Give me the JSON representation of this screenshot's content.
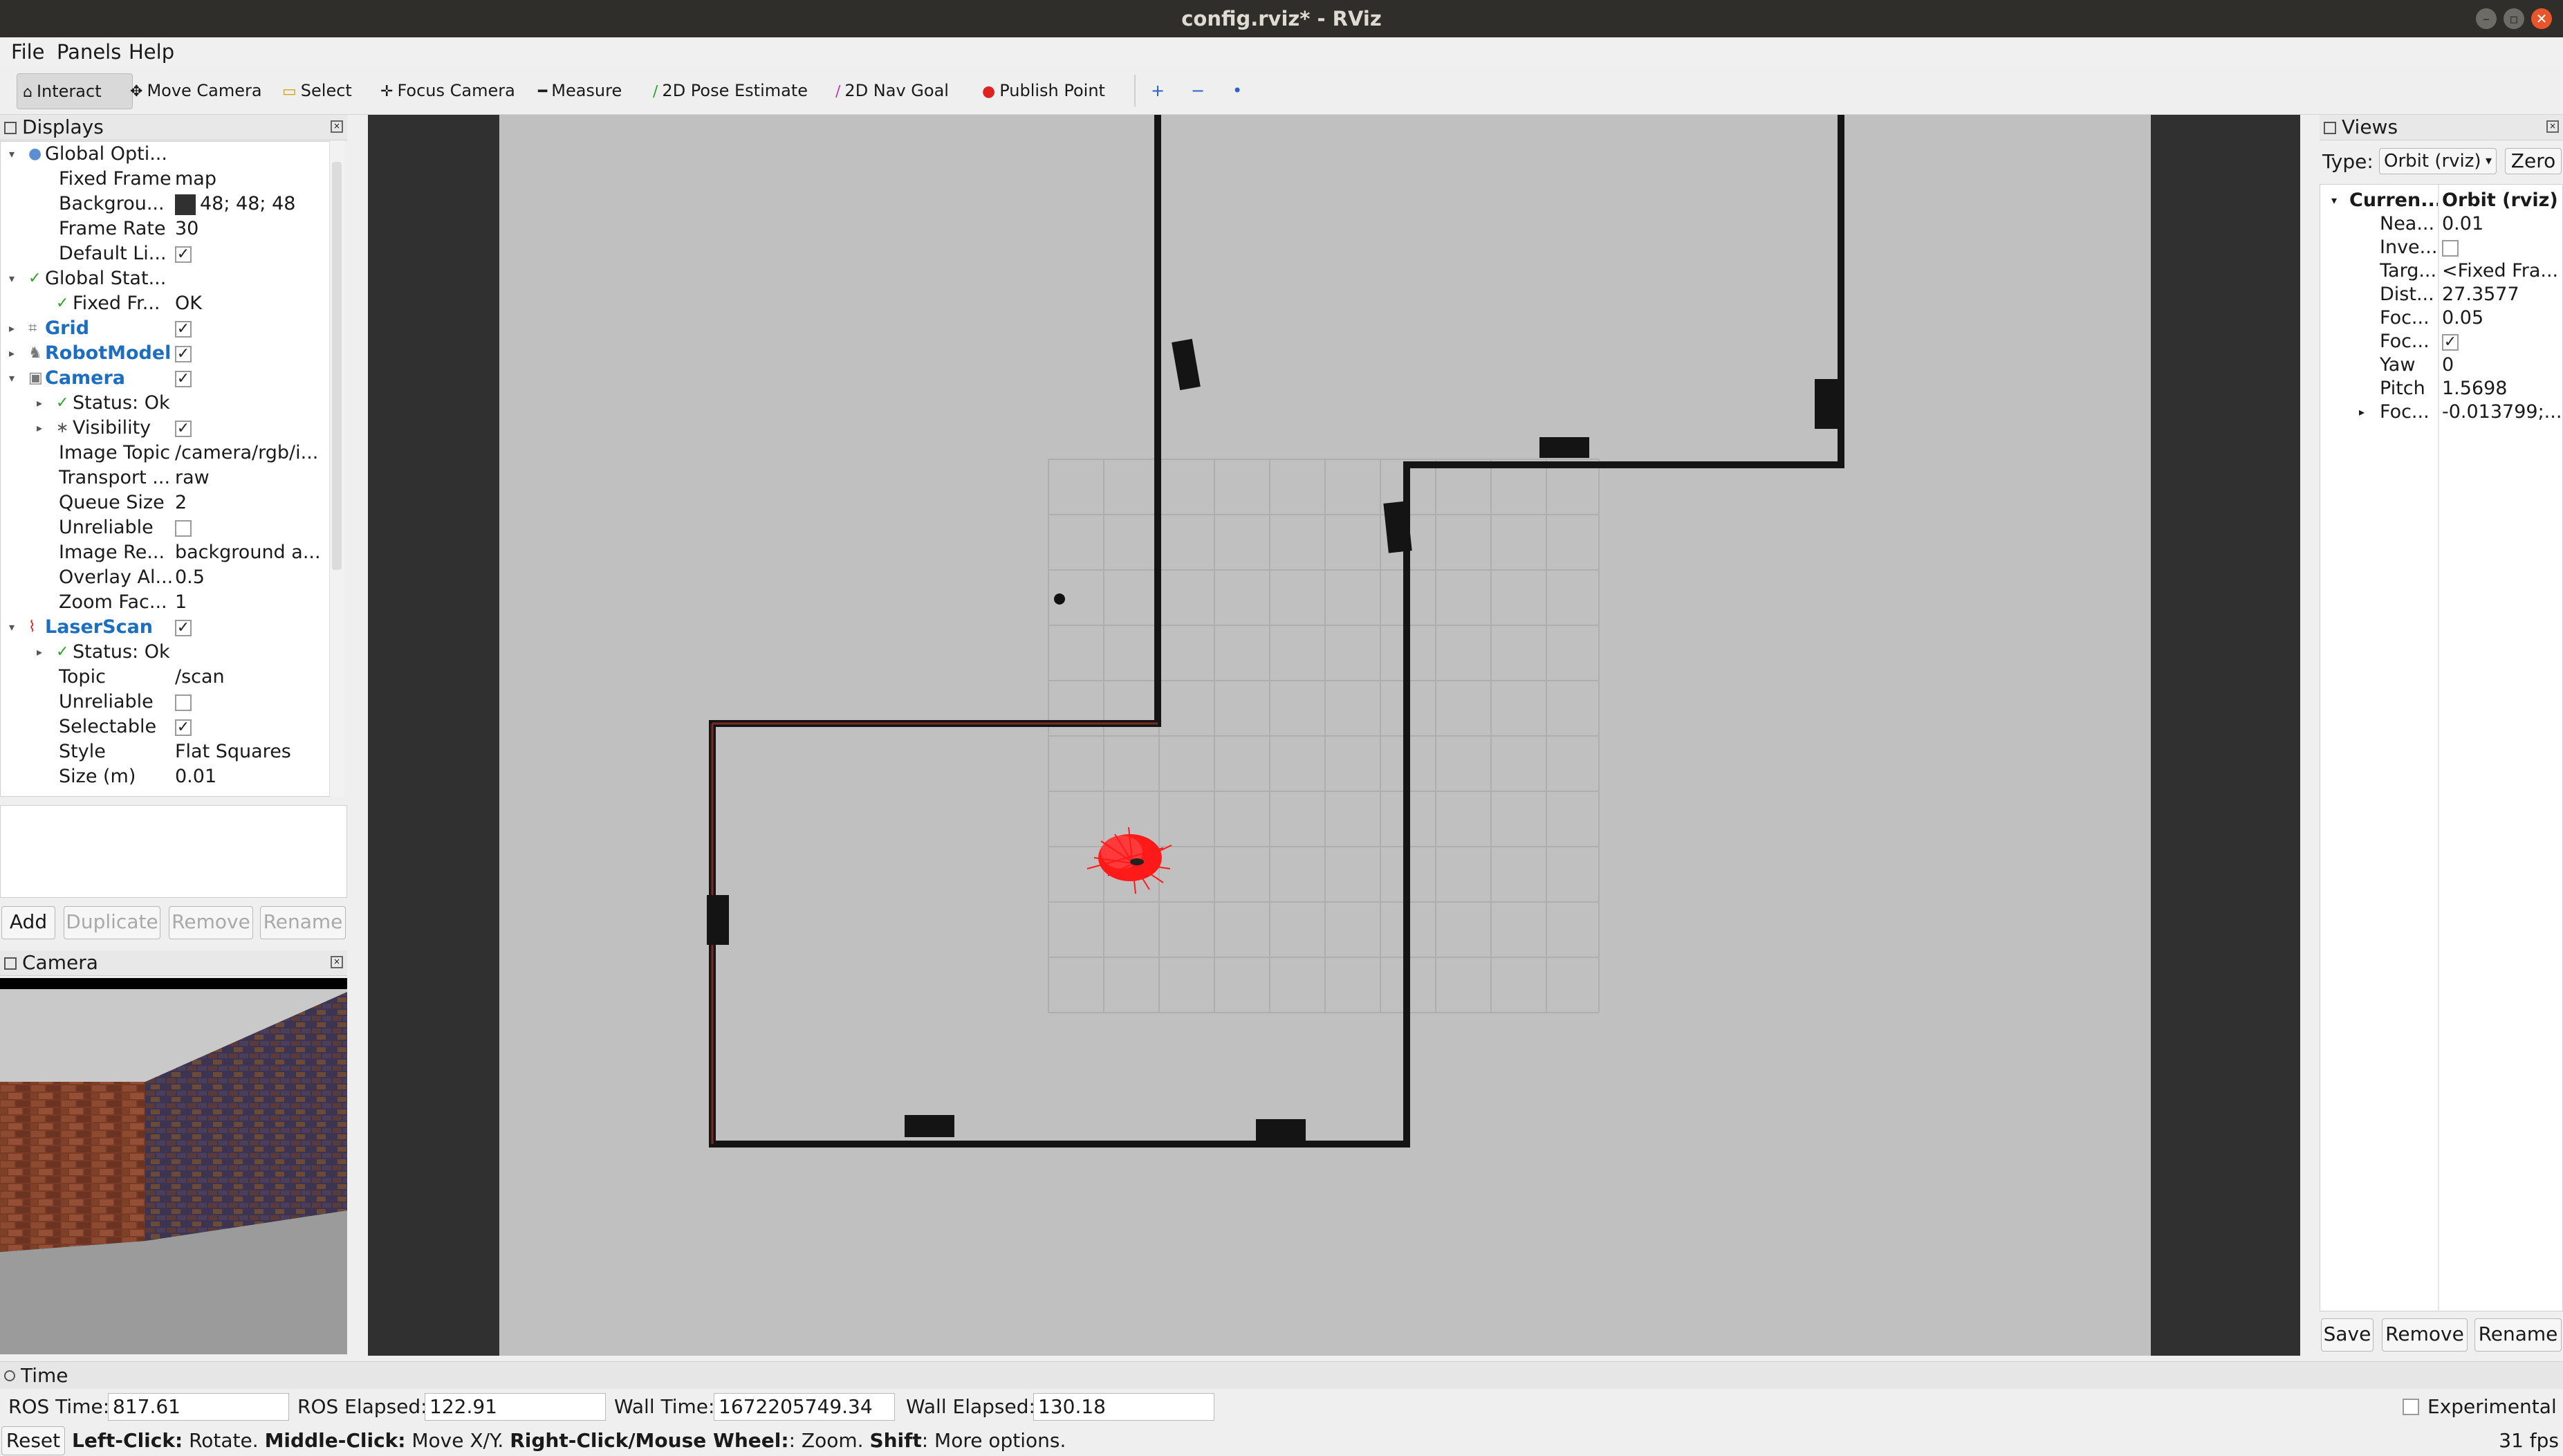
{
  "window": {
    "title": "config.rviz* - RViz"
  },
  "menu": [
    "File",
    "Panels",
    "Help"
  ],
  "toolbar": {
    "tools": [
      "Interact",
      "Move Camera",
      "Select",
      "Focus Camera",
      "Measure",
      "2D Pose Estimate",
      "2D Nav Goal",
      "Publish Point"
    ],
    "extra_icons": [
      "+",
      "−",
      "•"
    ]
  },
  "displays": {
    "title": "Displays",
    "rows": [
      {
        "label": "Global Opti...",
        "value": ""
      },
      {
        "label": "Fixed Frame",
        "value": "map"
      },
      {
        "label": "Backgrou...",
        "value": "48; 48; 48"
      },
      {
        "label": "Frame Rate",
        "value": "30"
      },
      {
        "label": "Default Li...",
        "value": "✓"
      },
      {
        "label": "Global Stat...",
        "value": ""
      },
      {
        "label": "Fixed Fr...",
        "value": "OK"
      },
      {
        "label": "Grid",
        "value": "✓"
      },
      {
        "label": "RobotModel",
        "value": "✓"
      },
      {
        "label": "Camera",
        "value": "✓"
      },
      {
        "label": "Status: Ok",
        "value": ""
      },
      {
        "label": "Visibility",
        "value": "✓"
      },
      {
        "label": "Image Topic",
        "value": "/camera/rgb/i..."
      },
      {
        "label": "Transport ...",
        "value": "raw"
      },
      {
        "label": "Queue Size",
        "value": "2"
      },
      {
        "label": "Unreliable",
        "value": ""
      },
      {
        "label": "Image Re...",
        "value": "background a..."
      },
      {
        "label": "Overlay Al...",
        "value": "0.5"
      },
      {
        "label": "Zoom Fac...",
        "value": "1"
      },
      {
        "label": "LaserScan",
        "value": "✓"
      },
      {
        "label": "Status: Ok",
        "value": ""
      },
      {
        "label": "Topic",
        "value": "/scan"
      },
      {
        "label": "Unreliable",
        "value": ""
      },
      {
        "label": "Selectable",
        "value": "✓"
      },
      {
        "label": "Style",
        "value": "Flat Squares"
      },
      {
        "label": "Size (m)",
        "value": "0.01"
      }
    ],
    "buttons": [
      "Add",
      "Duplicate",
      "Remove",
      "Rename"
    ]
  },
  "camera_panel": {
    "title": "Camera"
  },
  "views": {
    "title": "Views",
    "type_label": "Type:",
    "type_value": "Orbit (rviz)",
    "zero_label": "Zero",
    "rows": [
      {
        "label": "Curren...",
        "value": "Orbit (rviz)"
      },
      {
        "label": "Nea...",
        "value": "0.01"
      },
      {
        "label": "Inve...",
        "value": ""
      },
      {
        "label": "Targ...",
        "value": "<Fixed Fra..."
      },
      {
        "label": "Dist...",
        "value": "27.3577"
      },
      {
        "label": "Foc...",
        "value": "0.05"
      },
      {
        "label": "Foc...",
        "value": "✓"
      },
      {
        "label": "Yaw",
        "value": "0"
      },
      {
        "label": "Pitch",
        "value": "1.5698"
      },
      {
        "label": "Foc...",
        "value": "-0.013799;..."
      }
    ],
    "buttons": [
      "Save",
      "Remove",
      "Rename"
    ]
  },
  "time": {
    "title": "Time",
    "ros_time_label": "ROS Time:",
    "ros_time": "817.61",
    "ros_elapsed_label": "ROS Elapsed:",
    "ros_elapsed": "122.91",
    "wall_time_label": "Wall Time:",
    "wall_time": "1672205749.34",
    "wall_elapsed_label": "Wall Elapsed:",
    "wall_elapsed": "130.18",
    "experimental_label": "Experimental"
  },
  "status": {
    "reset_label": "Reset",
    "k1": "Left-Click:",
    "t1": " Rotate. ",
    "k2": "Middle-Click:",
    "t2": " Move X/Y. ",
    "k3": "Right-Click/Mouse Wheel:",
    "t3": ": Zoom. ",
    "k4": "Shift",
    "t4": ": More options.",
    "fps": "31 fps"
  }
}
